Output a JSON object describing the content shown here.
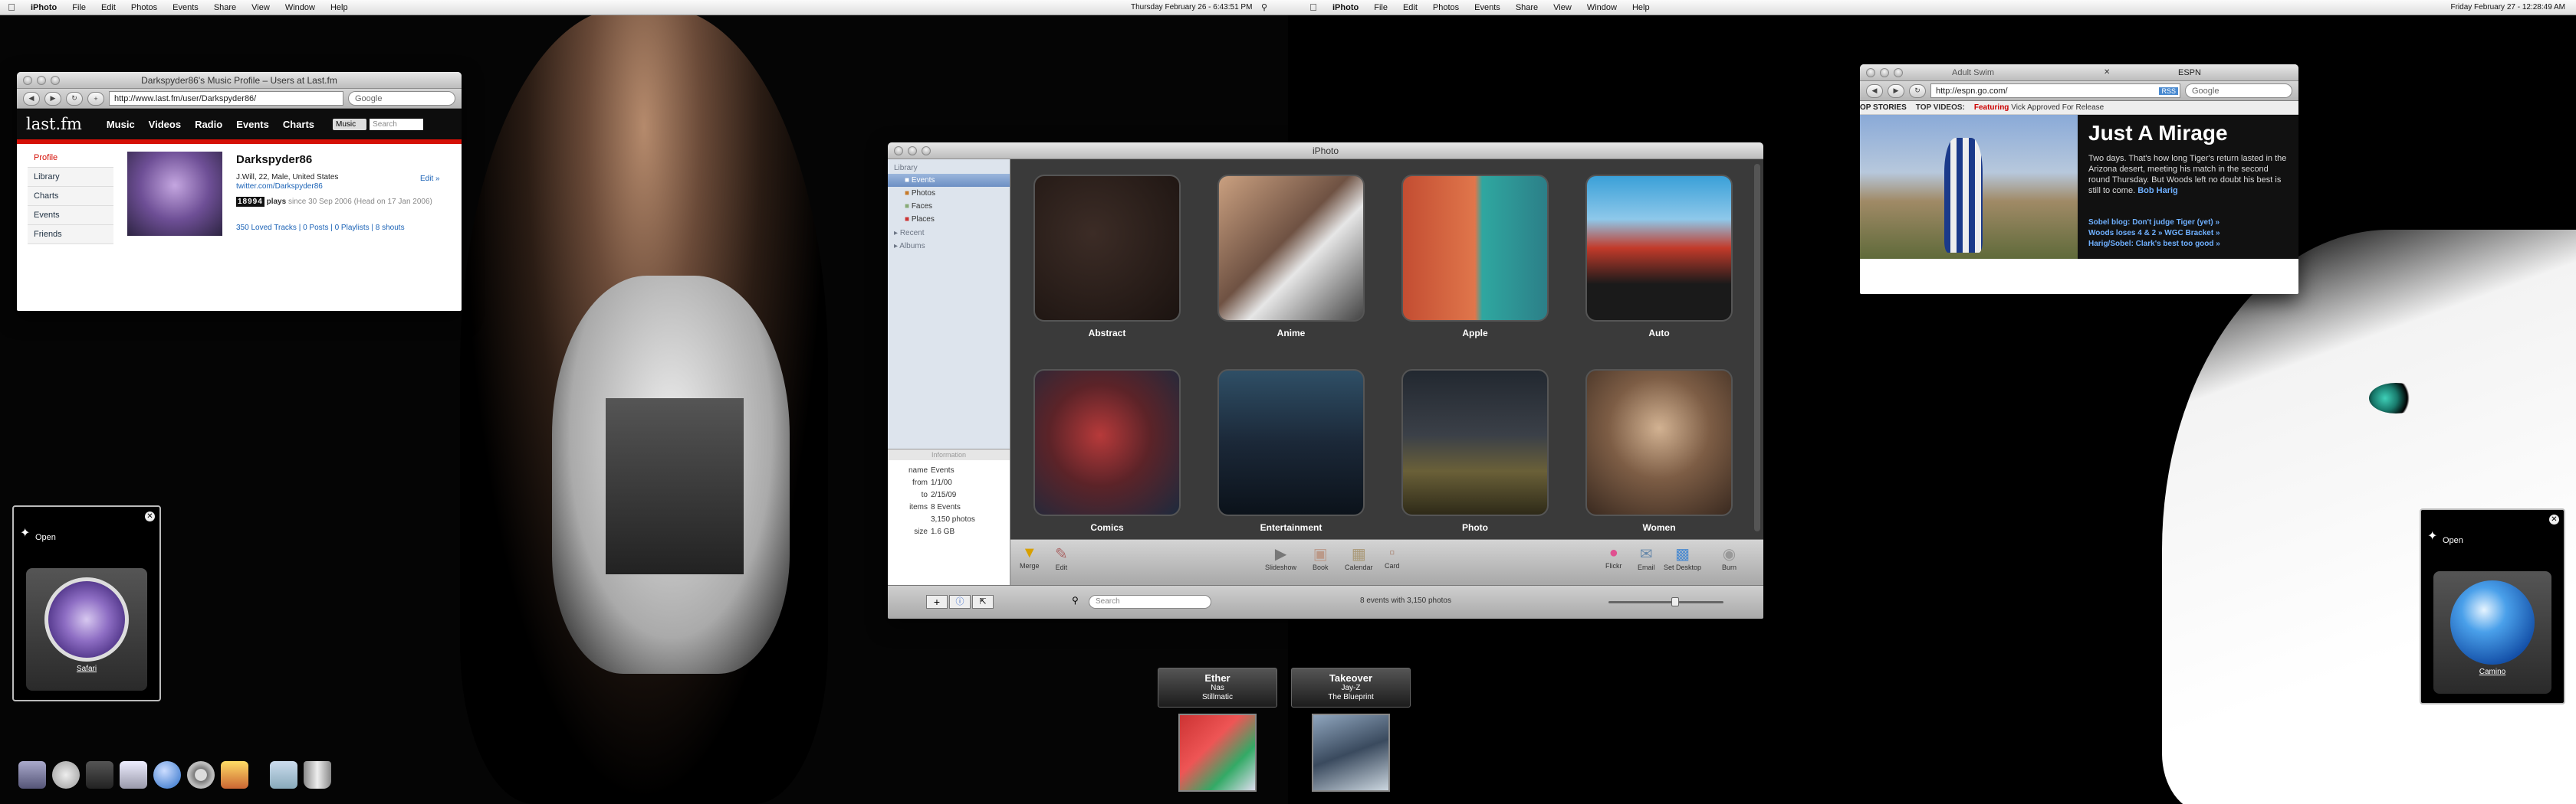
{
  "menubar_left": {
    "items": [
      "iPhoto",
      "File",
      "Edit",
      "Photos",
      "Events",
      "Share",
      "View",
      "Window",
      "Help"
    ],
    "clock": "Thursday February 26 - 6:43:51 PM"
  },
  "menubar_right": {
    "items": [
      "iPhoto",
      "File",
      "Edit",
      "Photos",
      "Events",
      "Share",
      "View",
      "Window",
      "Help"
    ],
    "clock": "Friday February 27 - 12:28:49 AM"
  },
  "lastfm": {
    "window_title": "Darkspyder86's Music Profile – Users at Last.fm",
    "url": "http://www.last.fm/user/Darkspyder86/",
    "search_placeholder": "Google",
    "logo": "last.fm",
    "nav": [
      "Music",
      "Videos",
      "Radio",
      "Events",
      "Charts"
    ],
    "search_scope": "Music",
    "search_input": "Search",
    "sidebar": [
      "Profile",
      "Library",
      "Charts",
      "Events",
      "Friends"
    ],
    "username": "Darkspyder86",
    "bio": "J.Will, 22, Male, United States",
    "twitter": "twitter.com/Darkspyder86",
    "edit": "Edit »",
    "plays_count": "18994",
    "plays_label": "plays",
    "plays_since": "since 30 Sep 2006 (Head on 17 Jan 2006)",
    "links": "350 Loved Tracks | 0 Posts | 0 Playlists | 8 shouts"
  },
  "iphoto": {
    "window_title": "iPhoto",
    "library_header": "Library",
    "library_items": [
      "Events",
      "Photos",
      "Faces",
      "Places"
    ],
    "groups": [
      "Recent",
      "Albums"
    ],
    "info_header": "Information",
    "info": [
      {
        "k": "name",
        "v": "Events"
      },
      {
        "k": "from",
        "v": "1/1/00"
      },
      {
        "k": "to",
        "v": "2/15/09"
      },
      {
        "k": "items",
        "v": "8 Events"
      },
      {
        "k": "",
        "v": "3,150 photos"
      },
      {
        "k": "size",
        "v": "1.6 GB"
      }
    ],
    "events": [
      "Abstract",
      "Anime",
      "Apple",
      "Auto",
      "Comics",
      "Entertainment",
      "Photo",
      "Women"
    ],
    "tools_left": [
      "Merge",
      "Edit"
    ],
    "tools_mid": [
      "Slideshow",
      "Book",
      "Calendar",
      "Card"
    ],
    "tools_right": [
      "Flickr",
      "Email",
      "Set Desktop",
      "Burn"
    ],
    "search_placeholder": "Search",
    "status": "8 events with 3,150 photos",
    "accent": "#7fa6d6"
  },
  "espn": {
    "tabs": [
      "Adult Swim",
      "ESPN"
    ],
    "url": "http://espn.go.com/",
    "rss": "RSS",
    "search_placeholder": "Google",
    "top_stories": "OP STORIES",
    "top_videos": "TOP VIDEOS:",
    "featuring": "Featuring",
    "featuring_text": "Vick Approved For Release",
    "headline": "Just A Mirage",
    "body": "Two days. That's how long Tiger's return lasted in the Arizona desert, meeting his match in the second round Thursday. But Woods left no doubt his best is still to come.",
    "author": "Bob Harig",
    "bullets": [
      "Sobel blog: Don't judge Tiger (yet) »",
      "Woods loses 4 & 2 » WGC Bracket »",
      "Harig/Sobel: Clark's best too good »"
    ]
  },
  "widget_left": {
    "open": "Open",
    "label": "Safari"
  },
  "widget_right": {
    "open": "Open",
    "label": "Camino"
  },
  "albums": [
    {
      "title": "Ether",
      "artist": "Nas",
      "album": "Stillmatic",
      "art_color": "#c33"
    },
    {
      "title": "Takeover",
      "artist": "Jay-Z",
      "album": "The Blueprint",
      "art_color": "#3a4a5e"
    }
  ],
  "dock_icons": [
    "finder-icon",
    "safari-icon",
    "itunes-icon",
    "mail-icon",
    "globe-icon",
    "gear-icon",
    "iphoto-icon",
    "folder-icon",
    "trash-icon"
  ]
}
